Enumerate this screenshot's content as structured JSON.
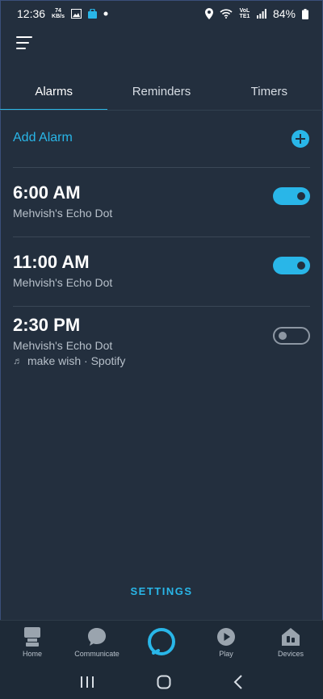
{
  "status_bar": {
    "time": "12:36",
    "kbps_value": "74",
    "kbps_unit": "KB/s",
    "network_label": "VoLTE1",
    "battery": "84%"
  },
  "tabs": [
    {
      "label": "Alarms",
      "active": true
    },
    {
      "label": "Reminders",
      "active": false
    },
    {
      "label": "Timers",
      "active": false
    }
  ],
  "add_alarm_label": "Add Alarm",
  "alarms": [
    {
      "time": "6:00 AM",
      "device": "Mehvish's Echo Dot",
      "enabled": true
    },
    {
      "time": "11:00 AM",
      "device": "Mehvish's Echo Dot",
      "enabled": true
    },
    {
      "time": "2:30 PM",
      "device": "Mehvish's Echo Dot",
      "music": "make wish · Spotify",
      "enabled": false
    }
  ],
  "settings_label": "SETTINGS",
  "bottom_nav": [
    {
      "label": "Home",
      "icon": "home-icon"
    },
    {
      "label": "Communicate",
      "icon": "chat-bubble-icon"
    },
    {
      "label": "",
      "icon": "alexa-ring-icon"
    },
    {
      "label": "Play",
      "icon": "play-icon"
    },
    {
      "label": "Devices",
      "icon": "devices-icon"
    }
  ],
  "colors": {
    "background": "#232f3e",
    "accent": "#29b6e8",
    "nav_background": "#1e2a37"
  }
}
